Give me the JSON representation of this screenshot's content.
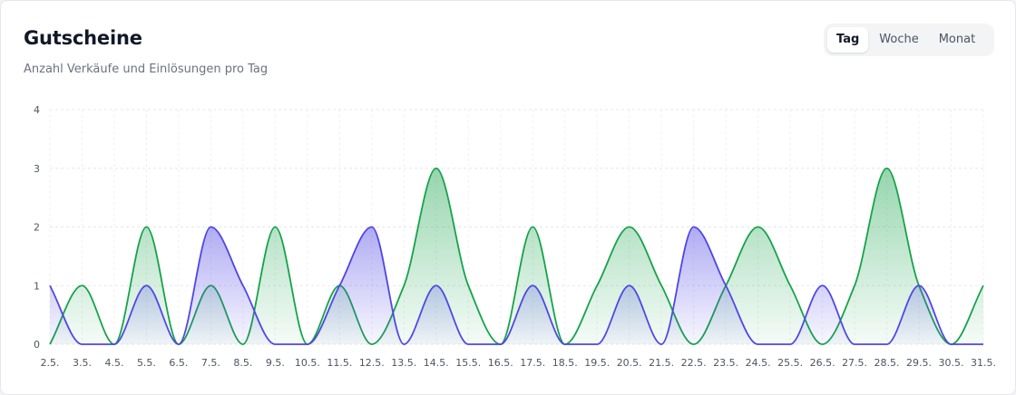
{
  "card": {
    "title": "Gutscheine",
    "subtitle": "Anzahl Verkäufe und Einlösungen pro Tag"
  },
  "range_toggle": {
    "options": [
      "Tag",
      "Woche",
      "Monat"
    ],
    "selected": "Tag"
  },
  "chart_data": {
    "type": "area",
    "x": [
      "2.5.",
      "3.5.",
      "4.5.",
      "5.5.",
      "6.5.",
      "7.5.",
      "8.5.",
      "9.5.",
      "10.5.",
      "11.5.",
      "12.5.",
      "13.5.",
      "14.5.",
      "15.5.",
      "16.5.",
      "17.5.",
      "18.5.",
      "19.5.",
      "20.5.",
      "21.5.",
      "22.5.",
      "23.5.",
      "24.5.",
      "25.5.",
      "26.5.",
      "27.5.",
      "28.5.",
      "29.5.",
      "30.5.",
      "31.5."
    ],
    "ylim": [
      0,
      4
    ],
    "yticks": [
      0,
      1,
      2,
      3,
      4
    ],
    "grid": true,
    "series": [
      {
        "color": "#16a34a",
        "values": [
          0,
          1,
          0,
          2,
          0,
          1,
          0,
          2,
          0,
          1,
          0,
          1,
          3,
          1,
          0,
          2,
          0,
          1,
          2,
          1,
          0,
          1,
          2,
          1,
          0,
          1,
          3,
          1,
          0,
          1
        ]
      },
      {
        "color": "#4f46e5",
        "values": [
          1,
          0,
          0,
          1,
          0,
          2,
          1,
          0,
          0,
          1,
          2,
          0,
          1,
          0,
          0,
          1,
          0,
          0,
          1,
          0,
          2,
          1,
          0,
          0,
          1,
          0,
          0,
          1,
          0,
          0
        ]
      }
    ]
  }
}
